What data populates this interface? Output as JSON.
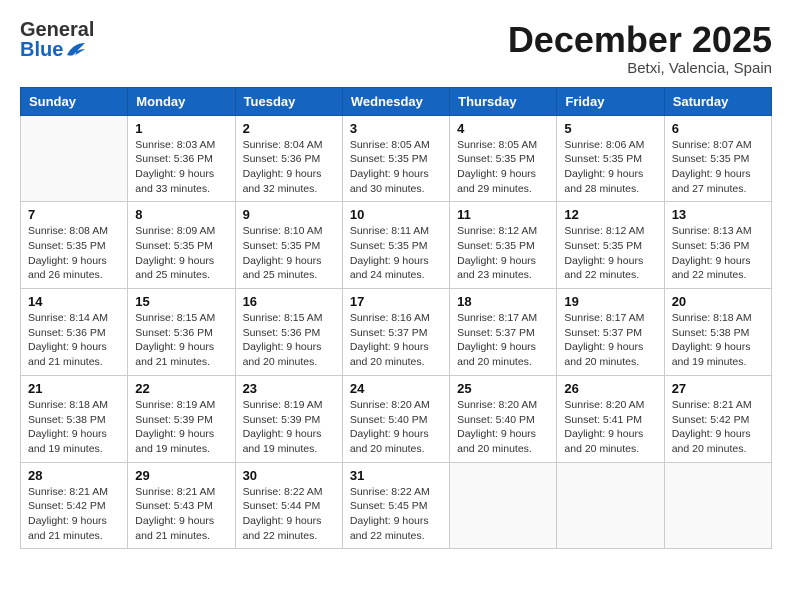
{
  "header": {
    "logo_general": "General",
    "logo_blue": "Blue",
    "month": "December 2025",
    "location": "Betxi, Valencia, Spain"
  },
  "weekdays": [
    "Sunday",
    "Monday",
    "Tuesday",
    "Wednesday",
    "Thursday",
    "Friday",
    "Saturday"
  ],
  "weeks": [
    [
      {
        "day": "",
        "sunrise": "",
        "sunset": "",
        "daylight": ""
      },
      {
        "day": "1",
        "sunrise": "Sunrise: 8:03 AM",
        "sunset": "Sunset: 5:36 PM",
        "daylight": "Daylight: 9 hours and 33 minutes."
      },
      {
        "day": "2",
        "sunrise": "Sunrise: 8:04 AM",
        "sunset": "Sunset: 5:36 PM",
        "daylight": "Daylight: 9 hours and 32 minutes."
      },
      {
        "day": "3",
        "sunrise": "Sunrise: 8:05 AM",
        "sunset": "Sunset: 5:35 PM",
        "daylight": "Daylight: 9 hours and 30 minutes."
      },
      {
        "day": "4",
        "sunrise": "Sunrise: 8:05 AM",
        "sunset": "Sunset: 5:35 PM",
        "daylight": "Daylight: 9 hours and 29 minutes."
      },
      {
        "day": "5",
        "sunrise": "Sunrise: 8:06 AM",
        "sunset": "Sunset: 5:35 PM",
        "daylight": "Daylight: 9 hours and 28 minutes."
      },
      {
        "day": "6",
        "sunrise": "Sunrise: 8:07 AM",
        "sunset": "Sunset: 5:35 PM",
        "daylight": "Daylight: 9 hours and 27 minutes."
      }
    ],
    [
      {
        "day": "7",
        "sunrise": "Sunrise: 8:08 AM",
        "sunset": "Sunset: 5:35 PM",
        "daylight": "Daylight: 9 hours and 26 minutes."
      },
      {
        "day": "8",
        "sunrise": "Sunrise: 8:09 AM",
        "sunset": "Sunset: 5:35 PM",
        "daylight": "Daylight: 9 hours and 25 minutes."
      },
      {
        "day": "9",
        "sunrise": "Sunrise: 8:10 AM",
        "sunset": "Sunset: 5:35 PM",
        "daylight": "Daylight: 9 hours and 25 minutes."
      },
      {
        "day": "10",
        "sunrise": "Sunrise: 8:11 AM",
        "sunset": "Sunset: 5:35 PM",
        "daylight": "Daylight: 9 hours and 24 minutes."
      },
      {
        "day": "11",
        "sunrise": "Sunrise: 8:12 AM",
        "sunset": "Sunset: 5:35 PM",
        "daylight": "Daylight: 9 hours and 23 minutes."
      },
      {
        "day": "12",
        "sunrise": "Sunrise: 8:12 AM",
        "sunset": "Sunset: 5:35 PM",
        "daylight": "Daylight: 9 hours and 22 minutes."
      },
      {
        "day": "13",
        "sunrise": "Sunrise: 8:13 AM",
        "sunset": "Sunset: 5:36 PM",
        "daylight": "Daylight: 9 hours and 22 minutes."
      }
    ],
    [
      {
        "day": "14",
        "sunrise": "Sunrise: 8:14 AM",
        "sunset": "Sunset: 5:36 PM",
        "daylight": "Daylight: 9 hours and 21 minutes."
      },
      {
        "day": "15",
        "sunrise": "Sunrise: 8:15 AM",
        "sunset": "Sunset: 5:36 PM",
        "daylight": "Daylight: 9 hours and 21 minutes."
      },
      {
        "day": "16",
        "sunrise": "Sunrise: 8:15 AM",
        "sunset": "Sunset: 5:36 PM",
        "daylight": "Daylight: 9 hours and 20 minutes."
      },
      {
        "day": "17",
        "sunrise": "Sunrise: 8:16 AM",
        "sunset": "Sunset: 5:37 PM",
        "daylight": "Daylight: 9 hours and 20 minutes."
      },
      {
        "day": "18",
        "sunrise": "Sunrise: 8:17 AM",
        "sunset": "Sunset: 5:37 PM",
        "daylight": "Daylight: 9 hours and 20 minutes."
      },
      {
        "day": "19",
        "sunrise": "Sunrise: 8:17 AM",
        "sunset": "Sunset: 5:37 PM",
        "daylight": "Daylight: 9 hours and 20 minutes."
      },
      {
        "day": "20",
        "sunrise": "Sunrise: 8:18 AM",
        "sunset": "Sunset: 5:38 PM",
        "daylight": "Daylight: 9 hours and 19 minutes."
      }
    ],
    [
      {
        "day": "21",
        "sunrise": "Sunrise: 8:18 AM",
        "sunset": "Sunset: 5:38 PM",
        "daylight": "Daylight: 9 hours and 19 minutes."
      },
      {
        "day": "22",
        "sunrise": "Sunrise: 8:19 AM",
        "sunset": "Sunset: 5:39 PM",
        "daylight": "Daylight: 9 hours and 19 minutes."
      },
      {
        "day": "23",
        "sunrise": "Sunrise: 8:19 AM",
        "sunset": "Sunset: 5:39 PM",
        "daylight": "Daylight: 9 hours and 19 minutes."
      },
      {
        "day": "24",
        "sunrise": "Sunrise: 8:20 AM",
        "sunset": "Sunset: 5:40 PM",
        "daylight": "Daylight: 9 hours and 20 minutes."
      },
      {
        "day": "25",
        "sunrise": "Sunrise: 8:20 AM",
        "sunset": "Sunset: 5:40 PM",
        "daylight": "Daylight: 9 hours and 20 minutes."
      },
      {
        "day": "26",
        "sunrise": "Sunrise: 8:20 AM",
        "sunset": "Sunset: 5:41 PM",
        "daylight": "Daylight: 9 hours and 20 minutes."
      },
      {
        "day": "27",
        "sunrise": "Sunrise: 8:21 AM",
        "sunset": "Sunset: 5:42 PM",
        "daylight": "Daylight: 9 hours and 20 minutes."
      }
    ],
    [
      {
        "day": "28",
        "sunrise": "Sunrise: 8:21 AM",
        "sunset": "Sunset: 5:42 PM",
        "daylight": "Daylight: 9 hours and 21 minutes."
      },
      {
        "day": "29",
        "sunrise": "Sunrise: 8:21 AM",
        "sunset": "Sunset: 5:43 PM",
        "daylight": "Daylight: 9 hours and 21 minutes."
      },
      {
        "day": "30",
        "sunrise": "Sunrise: 8:22 AM",
        "sunset": "Sunset: 5:44 PM",
        "daylight": "Daylight: 9 hours and 22 minutes."
      },
      {
        "day": "31",
        "sunrise": "Sunrise: 8:22 AM",
        "sunset": "Sunset: 5:45 PM",
        "daylight": "Daylight: 9 hours and 22 minutes."
      },
      {
        "day": "",
        "sunrise": "",
        "sunset": "",
        "daylight": ""
      },
      {
        "day": "",
        "sunrise": "",
        "sunset": "",
        "daylight": ""
      },
      {
        "day": "",
        "sunrise": "",
        "sunset": "",
        "daylight": ""
      }
    ]
  ]
}
